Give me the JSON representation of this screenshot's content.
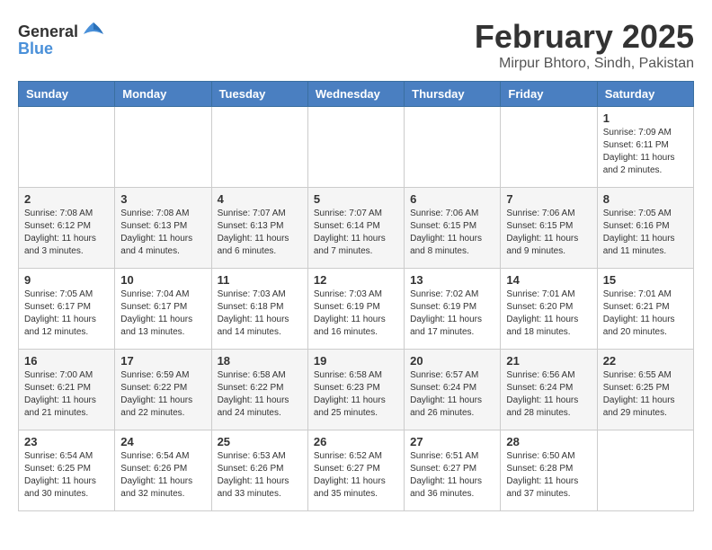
{
  "logo": {
    "text_general": "General",
    "text_blue": "Blue"
  },
  "title": "February 2025",
  "subtitle": "Mirpur Bhtoro, Sindh, Pakistan",
  "days_of_week": [
    "Sunday",
    "Monday",
    "Tuesday",
    "Wednesday",
    "Thursday",
    "Friday",
    "Saturday"
  ],
  "weeks": [
    [
      {
        "day": "",
        "info": ""
      },
      {
        "day": "",
        "info": ""
      },
      {
        "day": "",
        "info": ""
      },
      {
        "day": "",
        "info": ""
      },
      {
        "day": "",
        "info": ""
      },
      {
        "day": "",
        "info": ""
      },
      {
        "day": "1",
        "info": "Sunrise: 7:09 AM\nSunset: 6:11 PM\nDaylight: 11 hours\nand 2 minutes."
      }
    ],
    [
      {
        "day": "2",
        "info": "Sunrise: 7:08 AM\nSunset: 6:12 PM\nDaylight: 11 hours\nand 3 minutes."
      },
      {
        "day": "3",
        "info": "Sunrise: 7:08 AM\nSunset: 6:13 PM\nDaylight: 11 hours\nand 4 minutes."
      },
      {
        "day": "4",
        "info": "Sunrise: 7:07 AM\nSunset: 6:13 PM\nDaylight: 11 hours\nand 6 minutes."
      },
      {
        "day": "5",
        "info": "Sunrise: 7:07 AM\nSunset: 6:14 PM\nDaylight: 11 hours\nand 7 minutes."
      },
      {
        "day": "6",
        "info": "Sunrise: 7:06 AM\nSunset: 6:15 PM\nDaylight: 11 hours\nand 8 minutes."
      },
      {
        "day": "7",
        "info": "Sunrise: 7:06 AM\nSunset: 6:15 PM\nDaylight: 11 hours\nand 9 minutes."
      },
      {
        "day": "8",
        "info": "Sunrise: 7:05 AM\nSunset: 6:16 PM\nDaylight: 11 hours\nand 11 minutes."
      }
    ],
    [
      {
        "day": "9",
        "info": "Sunrise: 7:05 AM\nSunset: 6:17 PM\nDaylight: 11 hours\nand 12 minutes."
      },
      {
        "day": "10",
        "info": "Sunrise: 7:04 AM\nSunset: 6:17 PM\nDaylight: 11 hours\nand 13 minutes."
      },
      {
        "day": "11",
        "info": "Sunrise: 7:03 AM\nSunset: 6:18 PM\nDaylight: 11 hours\nand 14 minutes."
      },
      {
        "day": "12",
        "info": "Sunrise: 7:03 AM\nSunset: 6:19 PM\nDaylight: 11 hours\nand 16 minutes."
      },
      {
        "day": "13",
        "info": "Sunrise: 7:02 AM\nSunset: 6:19 PM\nDaylight: 11 hours\nand 17 minutes."
      },
      {
        "day": "14",
        "info": "Sunrise: 7:01 AM\nSunset: 6:20 PM\nDaylight: 11 hours\nand 18 minutes."
      },
      {
        "day": "15",
        "info": "Sunrise: 7:01 AM\nSunset: 6:21 PM\nDaylight: 11 hours\nand 20 minutes."
      }
    ],
    [
      {
        "day": "16",
        "info": "Sunrise: 7:00 AM\nSunset: 6:21 PM\nDaylight: 11 hours\nand 21 minutes."
      },
      {
        "day": "17",
        "info": "Sunrise: 6:59 AM\nSunset: 6:22 PM\nDaylight: 11 hours\nand 22 minutes."
      },
      {
        "day": "18",
        "info": "Sunrise: 6:58 AM\nSunset: 6:22 PM\nDaylight: 11 hours\nand 24 minutes."
      },
      {
        "day": "19",
        "info": "Sunrise: 6:58 AM\nSunset: 6:23 PM\nDaylight: 11 hours\nand 25 minutes."
      },
      {
        "day": "20",
        "info": "Sunrise: 6:57 AM\nSunset: 6:24 PM\nDaylight: 11 hours\nand 26 minutes."
      },
      {
        "day": "21",
        "info": "Sunrise: 6:56 AM\nSunset: 6:24 PM\nDaylight: 11 hours\nand 28 minutes."
      },
      {
        "day": "22",
        "info": "Sunrise: 6:55 AM\nSunset: 6:25 PM\nDaylight: 11 hours\nand 29 minutes."
      }
    ],
    [
      {
        "day": "23",
        "info": "Sunrise: 6:54 AM\nSunset: 6:25 PM\nDaylight: 11 hours\nand 30 minutes."
      },
      {
        "day": "24",
        "info": "Sunrise: 6:54 AM\nSunset: 6:26 PM\nDaylight: 11 hours\nand 32 minutes."
      },
      {
        "day": "25",
        "info": "Sunrise: 6:53 AM\nSunset: 6:26 PM\nDaylight: 11 hours\nand 33 minutes."
      },
      {
        "day": "26",
        "info": "Sunrise: 6:52 AM\nSunset: 6:27 PM\nDaylight: 11 hours\nand 35 minutes."
      },
      {
        "day": "27",
        "info": "Sunrise: 6:51 AM\nSunset: 6:27 PM\nDaylight: 11 hours\nand 36 minutes."
      },
      {
        "day": "28",
        "info": "Sunrise: 6:50 AM\nSunset: 6:28 PM\nDaylight: 11 hours\nand 37 minutes."
      },
      {
        "day": "",
        "info": ""
      }
    ]
  ]
}
